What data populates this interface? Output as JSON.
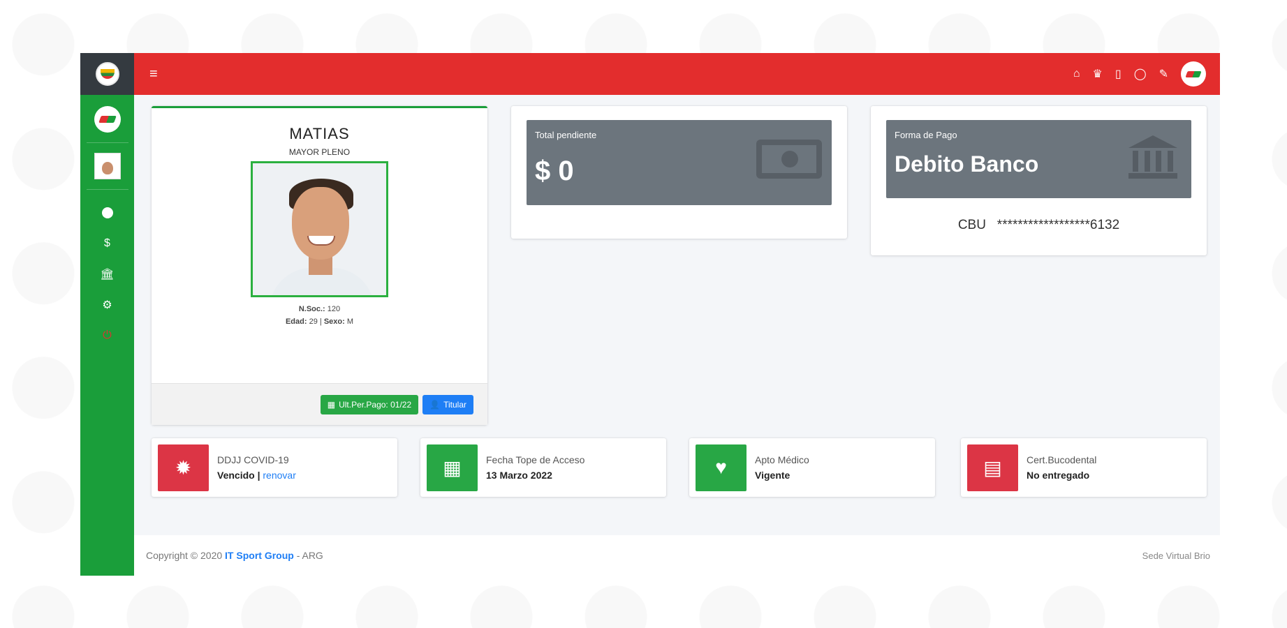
{
  "topbar": {
    "menu_icon": "hamburger-icon",
    "icons": [
      "home-icon",
      "crown-icon",
      "file-icon",
      "whatsapp-icon",
      "chat-icon"
    ]
  },
  "sidebar": {
    "nav": [
      {
        "icon": "info-icon",
        "glyph": "●"
      },
      {
        "icon": "dollar-icon",
        "glyph": "$"
      },
      {
        "icon": "bank-icon",
        "glyph": "🏛"
      },
      {
        "icon": "cogs-icon",
        "glyph": "⚙"
      },
      {
        "icon": "power-icon",
        "glyph": "⏻"
      }
    ]
  },
  "profile": {
    "name": "MATIAS",
    "category": "MAYOR PLENO",
    "socio_label": "N.Soc.:",
    "socio_value": "120",
    "edad_label": "Edad:",
    "edad_value": "29",
    "sexo_label": "Sexo:",
    "sexo_value": "M",
    "btn_pago": "Ult.Per.Pago: 01/22",
    "btn_titular": "Titular"
  },
  "pendiente": {
    "label": "Total pendiente",
    "value": "$ 0"
  },
  "pago": {
    "label": "Forma de Pago",
    "value": "Debito Banco",
    "cbu_label": "CBU",
    "cbu_value": "******************6132"
  },
  "status_cards": [
    {
      "label": "DDJJ COVID-19",
      "value": "Vencido",
      "sep": " | ",
      "link": "renovar",
      "color": "#dc3545",
      "icon": "virus-icon",
      "glyph": "✹"
    },
    {
      "label": "Fecha Tope de Acceso",
      "value": "13 Marzo 2022",
      "color": "#28a745",
      "icon": "calendar-icon",
      "glyph": "▦"
    },
    {
      "label": "Apto Médico",
      "value": "Vigente",
      "color": "#28a745",
      "icon": "heartbeat-icon",
      "glyph": "♥"
    },
    {
      "label": "Cert.Bucodental",
      "value": "No entregado",
      "color": "#dc3545",
      "icon": "teeth-icon",
      "glyph": "▤"
    }
  ],
  "footer": {
    "copyright": "Copyright © 2020",
    "company": "IT Sport Group",
    "suffix": "- ARG",
    "right": "Sede Virtual Brio"
  },
  "colors": {
    "topbar": "#e32d2d",
    "sidebar": "#1a9e3a",
    "brand": "#343a40",
    "info_box": "#6c757d",
    "link": "#1e7ef5"
  }
}
